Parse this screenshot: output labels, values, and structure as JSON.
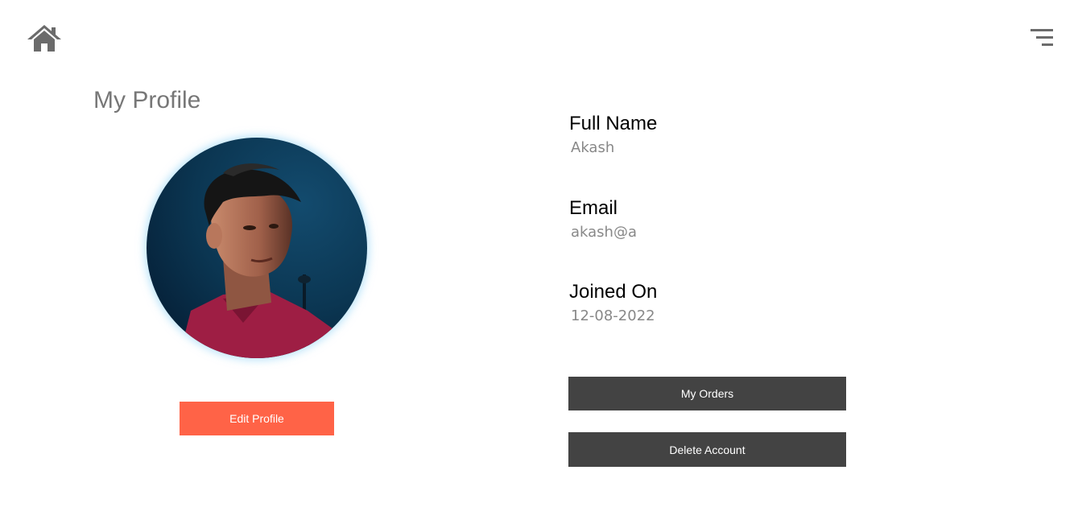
{
  "header": {
    "home_icon": "home-icon",
    "menu_icon": "menu-icon"
  },
  "profile": {
    "title": "My Profile",
    "avatar_alt": "profile photo",
    "edit_button": "Edit Profile"
  },
  "details": {
    "full_name_label": "Full Name",
    "full_name_value": "Akash",
    "email_label": "Email",
    "email_value": "akash@a",
    "joined_label": "Joined On",
    "joined_value": "12-08-2022"
  },
  "actions": {
    "orders_button": "My Orders",
    "delete_button": "Delete Account"
  },
  "colors": {
    "accent": "#ff6347",
    "dark_button": "#434343",
    "muted_text": "#777777"
  }
}
